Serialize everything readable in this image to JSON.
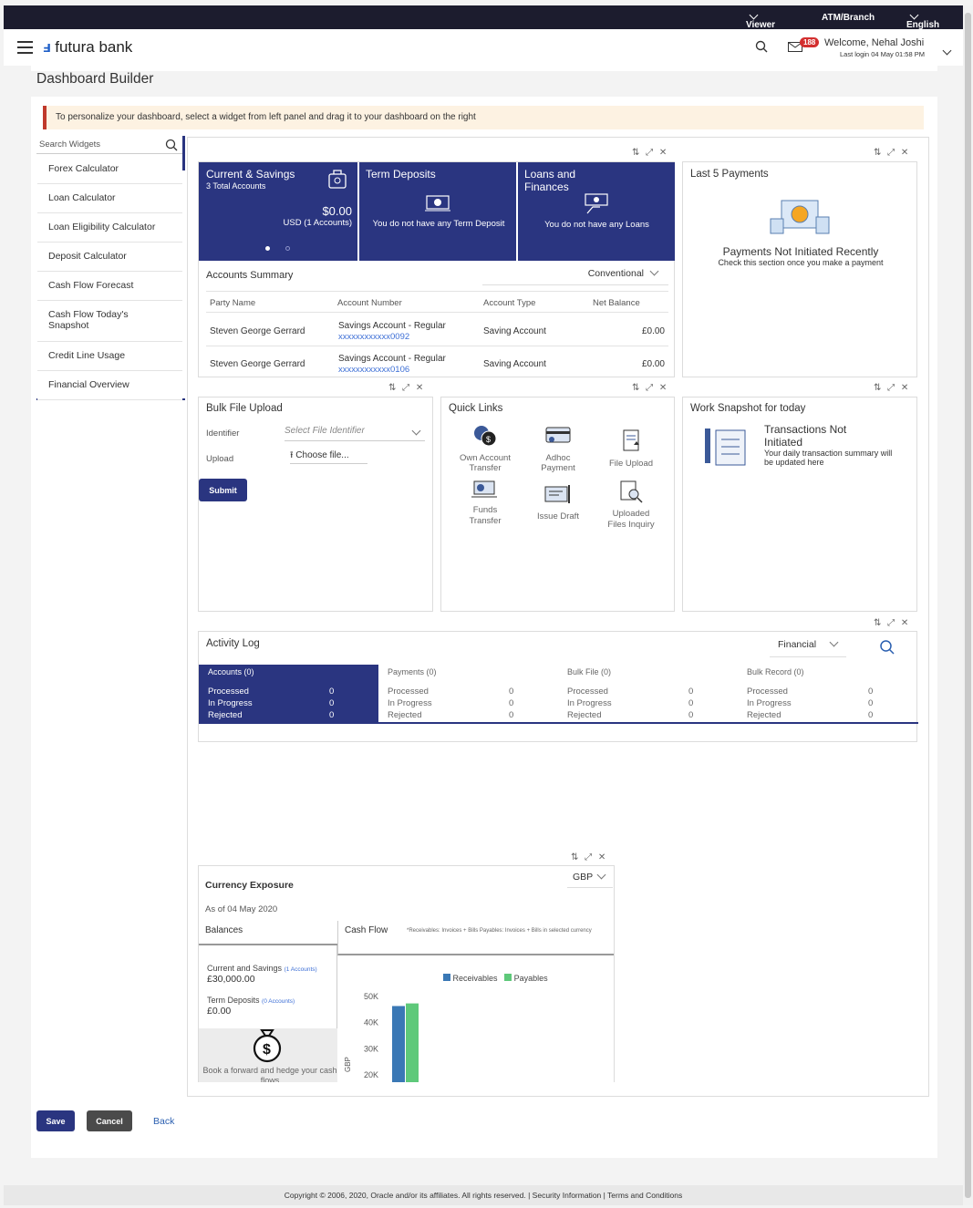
{
  "topbar": {
    "viewer": "Viewer",
    "atm": "ATM/Branch",
    "language": "English"
  },
  "header": {
    "brand": "futura bank",
    "notifications": "188",
    "welcome": "Welcome, Nehal Joshi",
    "last_login": "Last login 04 May 01:58 PM"
  },
  "page_title": "Dashboard Builder",
  "info_banner": "To personalize your dashboard, select a widget from left panel and drag it to your dashboard on the right",
  "sidebar": {
    "search_placeholder": "Search Widgets",
    "items": [
      {
        "label": "Forex Calculator"
      },
      {
        "label": "Loan Calculator"
      },
      {
        "label": "Loan Eligibility Calculator"
      },
      {
        "label": "Deposit Calculator"
      },
      {
        "label": "Cash Flow Forecast"
      },
      {
        "label": "Cash Flow Today's Snapshot"
      },
      {
        "label": "Credit Line Usage"
      },
      {
        "label": "Financial Overview"
      }
    ]
  },
  "accounts_widget": {
    "cs_title": "Current & Savings",
    "cs_subtitle": "3 Total Accounts",
    "cs_amount": "$0.00",
    "cs_currency": "USD (1 Accounts)",
    "td_title": "Term Deposits",
    "td_msg": "You do not have any Term Deposit",
    "loans_title": "Loans and Finances",
    "loans_msg": "You do not have any Loans",
    "summary_title": "Accounts Summary",
    "summary_filter": "Conventional",
    "columns": [
      "Party Name",
      "Account Number",
      "Account Type",
      "Net Balance"
    ],
    "rows": [
      {
        "party": "Steven George Gerrard",
        "acct_name": "Savings Account - Regular",
        "acct_no": "xxxxxxxxxxxx0092",
        "type": "Saving Account",
        "balance": "£0.00"
      },
      {
        "party": "Steven George Gerrard",
        "acct_name": "Savings Account - Regular",
        "acct_no": "xxxxxxxxxxxx0106",
        "type": "Saving Account",
        "balance": "£0.00"
      }
    ]
  },
  "last_payments": {
    "title": "Last 5 Payments",
    "msg": "Payments Not Initiated Recently",
    "sub": "Check this section once you make a payment"
  },
  "bulk_upload": {
    "title": "Bulk File Upload",
    "identifier_label": "Identifier",
    "identifier_placeholder": "Select File Identifier",
    "upload_label": "Upload",
    "choose": "Choose file...",
    "submit": "Submit"
  },
  "quick_links": {
    "title": "Quick Links",
    "items": [
      {
        "label": "Own Account Transfer"
      },
      {
        "label": "Adhoc Payment"
      },
      {
        "label": "File Upload"
      },
      {
        "label": "Funds Transfer"
      },
      {
        "label": "Issue Draft"
      },
      {
        "label": "Uploaded Files Inquiry"
      }
    ]
  },
  "work_snapshot": {
    "title": "Work Snapshot for today",
    "msg": "Transactions Not Initiated",
    "sub": "Your daily transaction summary will be updated here"
  },
  "activity_log": {
    "title": "Activity Log",
    "filter": "Financial",
    "groups": [
      {
        "name": "Accounts (0)",
        "processed": "0",
        "in_progress": "0",
        "rejected": "0"
      },
      {
        "name": "Payments (0)",
        "processed": "0",
        "in_progress": "0",
        "rejected": "0"
      },
      {
        "name": "Bulk File (0)",
        "processed": "0",
        "in_progress": "0",
        "rejected": "0"
      },
      {
        "name": "Bulk Record (0)",
        "processed": "0",
        "in_progress": "0",
        "rejected": "0"
      }
    ],
    "labels": {
      "processed": "Processed",
      "in_progress": "In Progress",
      "rejected": "Rejected"
    }
  },
  "currency_exposure": {
    "title": "Currency Exposure",
    "currency": "GBP",
    "as_of": "As of 04 May 2020",
    "balances_tab": "Balances",
    "cashflow_tab": "Cash Flow",
    "note": "*Receivables: Invoices + Bills Payables: Invoices + Bills  in selected currency",
    "cs_label": "Current and Savings",
    "cs_accounts": "(1 Accounts)",
    "cs_amount": "£30,000.00",
    "td_label": "Term Deposits",
    "td_accounts": "(0 Accounts)",
    "td_amount": "£0.00",
    "hedge_text": "Book a forward and hedge your cash flows"
  },
  "chart_data": {
    "type": "bar",
    "series": [
      {
        "name": "Receivables",
        "values": [
          46000
        ]
      },
      {
        "name": "Payables",
        "values": [
          47000
        ]
      }
    ],
    "ylabel": "GBP",
    "yticks": [
      "20K",
      "30K",
      "40K",
      "50K"
    ],
    "ylim": [
      20000,
      50000
    ],
    "legend": "top",
    "colors": {
      "Receivables": "#3a78b5",
      "Payables": "#5ec97a"
    }
  },
  "footer_actions": {
    "save": "Save",
    "cancel": "Cancel",
    "back": "Back"
  },
  "copyright": "Copyright © 2006, 2020, Oracle and/or its affiliates. All rights reserved. | Security Information | Terms and Conditions"
}
